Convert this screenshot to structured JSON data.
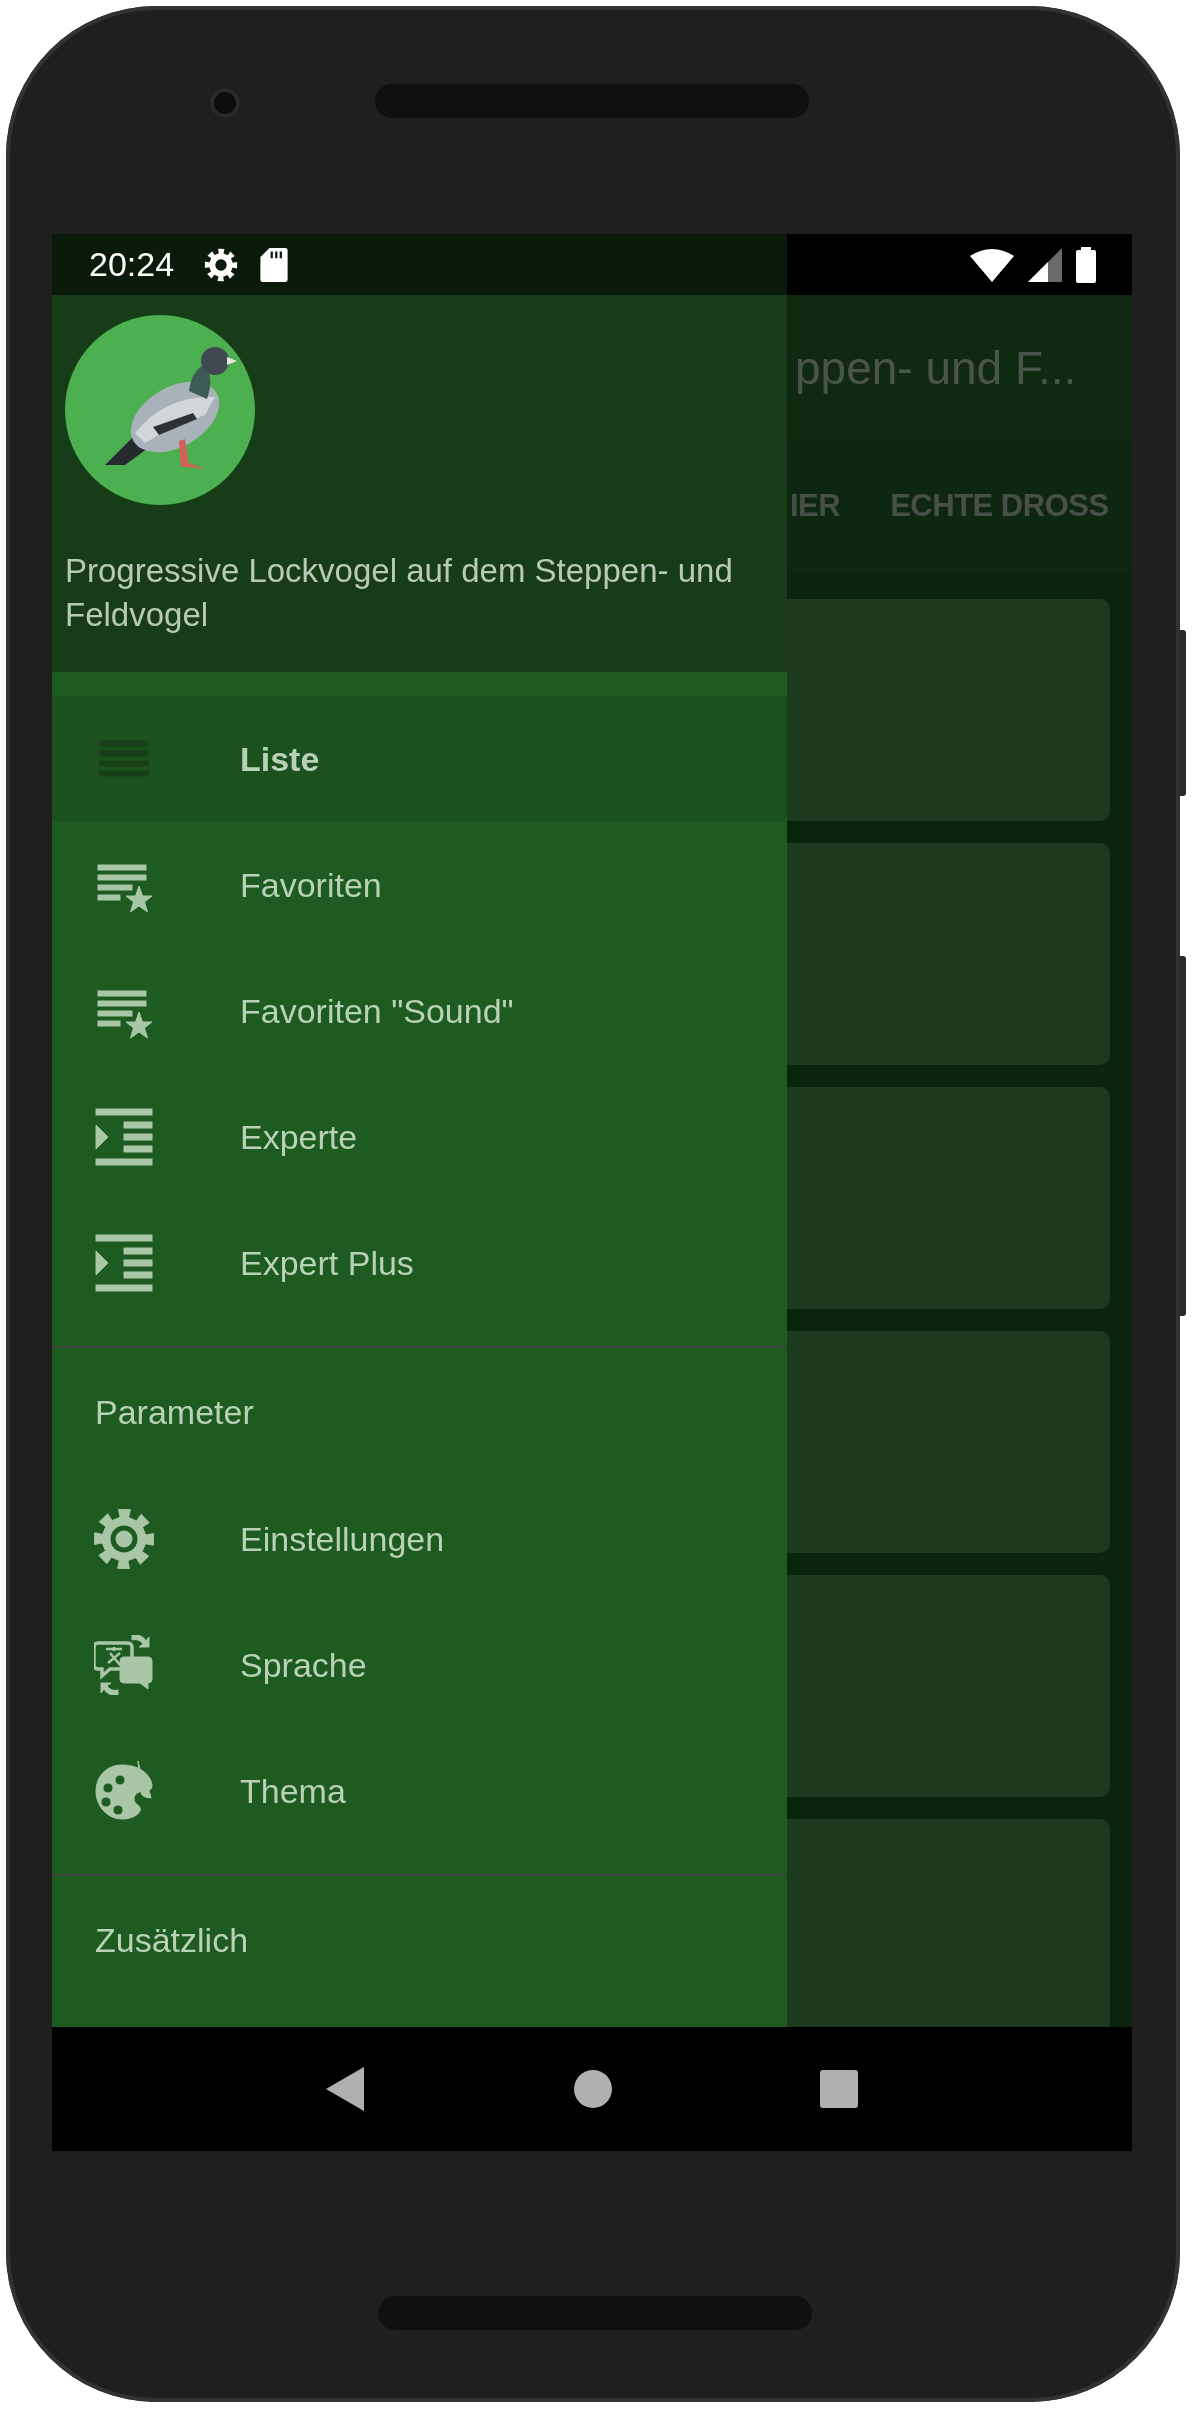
{
  "status_bar": {
    "time": "20:24"
  },
  "background_app": {
    "title": "ppen- und F...",
    "tabs": [
      {
        "label": "IER"
      },
      {
        "label": "ECHTE DROSS"
      }
    ]
  },
  "drawer": {
    "header": {
      "subtitle": "Progressive Lockvogel auf dem Steppen- und Feldvogel"
    },
    "sections": [
      {
        "items": [
          {
            "label": "Liste",
            "selected": true
          },
          {
            "label": "Favoriten",
            "selected": false
          },
          {
            "label": "Favoriten \"Sound\"",
            "selected": false
          },
          {
            "label": "Experte",
            "selected": false
          },
          {
            "label": "Expert Plus",
            "selected": false
          }
        ]
      },
      {
        "title": "Parameter",
        "items": [
          {
            "label": "Einstellungen",
            "selected": false
          },
          {
            "label": "Sprache",
            "selected": false
          },
          {
            "label": "Thema",
            "selected": false
          }
        ]
      },
      {
        "title": "Zusätzlich"
      }
    ]
  }
}
